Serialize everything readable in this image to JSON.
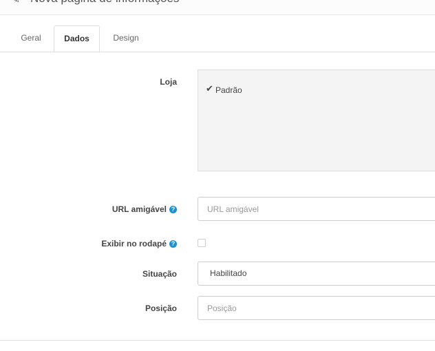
{
  "header": {
    "title": "Nova página de informações",
    "icon": "pencil-icon"
  },
  "tabs": [
    {
      "label": "Geral",
      "active": false
    },
    {
      "label": "Dados",
      "active": true
    },
    {
      "label": "Design",
      "active": false
    }
  ],
  "form": {
    "store": {
      "label": "Loja",
      "option_label": "Padrão",
      "checked": true
    },
    "seo_url": {
      "label": "URL amigável",
      "placeholder": "URL amigável",
      "value": "",
      "help_icon": "question-circle-icon"
    },
    "bottom": {
      "label": "Exibir no rodapé",
      "checked": false,
      "help_icon": "question-circle-icon"
    },
    "status": {
      "label": "Situação",
      "selected": "Habilitado"
    },
    "sort_order": {
      "label": "Posição",
      "placeholder": "Posição",
      "value": ""
    }
  },
  "colors": {
    "help_icon": "#1e91cf",
    "active_tab_text": "#333333",
    "well_background": "#f4f4f4"
  }
}
